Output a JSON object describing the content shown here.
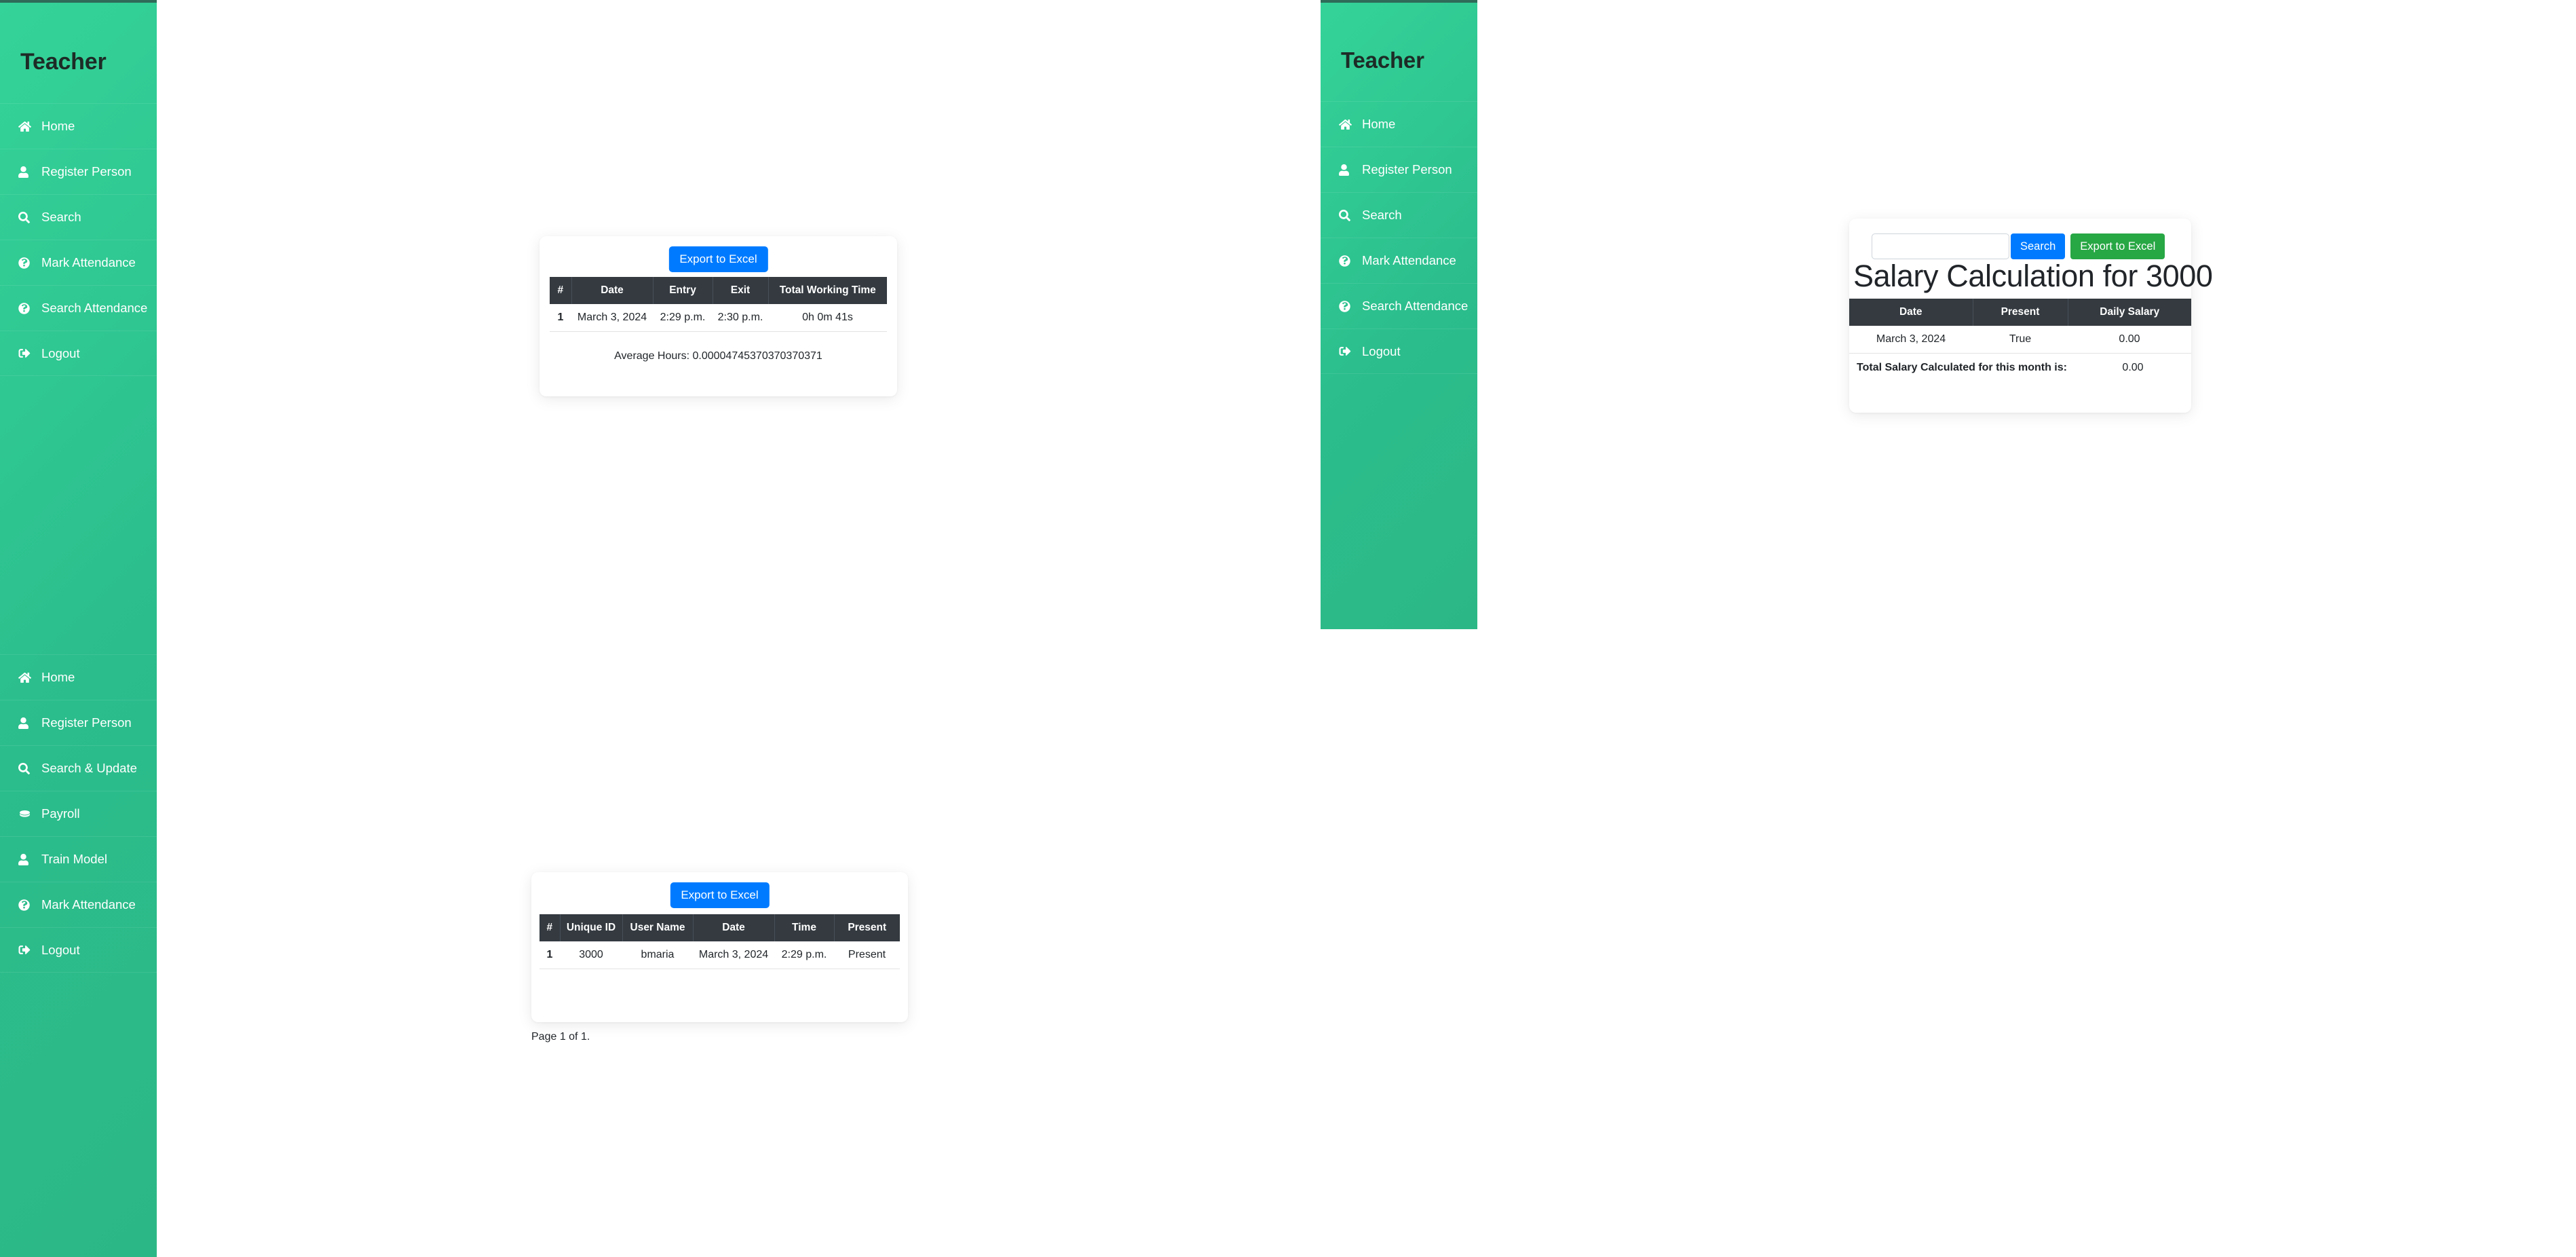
{
  "theme": {
    "sidebar_gradient_from": "#34d399",
    "sidebar_gradient_to": "#2cb886",
    "table_header_bg": "#343a40",
    "primary_button": "#007bff",
    "success_button": "#28a745"
  },
  "sidebar_primary": {
    "brand": "Teacher",
    "group_one": [
      {
        "label": "Home",
        "icon": "home-icon"
      },
      {
        "label": "Register Person",
        "icon": "user-icon"
      },
      {
        "label": "Search",
        "icon": "search-icon"
      },
      {
        "label": "Mark Attendance",
        "icon": "question-circle-icon"
      },
      {
        "label": "Search Attendance",
        "icon": "question-circle-icon"
      },
      {
        "label": "Logout",
        "icon": "logout-icon"
      }
    ],
    "group_two": [
      {
        "label": "Home",
        "icon": "home-icon"
      },
      {
        "label": "Register Person",
        "icon": "user-icon"
      },
      {
        "label": "Search & Update",
        "icon": "search-icon"
      },
      {
        "label": "Payroll",
        "icon": "coin-icon"
      },
      {
        "label": "Train Model",
        "icon": "user-icon"
      },
      {
        "label": "Mark Attendance",
        "icon": "question-circle-icon"
      },
      {
        "label": "Logout",
        "icon": "logout-icon"
      }
    ]
  },
  "sidebar_secondary": {
    "brand": "Teacher",
    "items": [
      {
        "label": "Home",
        "icon": "home-icon"
      },
      {
        "label": "Register Person",
        "icon": "user-icon"
      },
      {
        "label": "Search",
        "icon": "search-icon"
      },
      {
        "label": "Mark Attendance",
        "icon": "question-circle-icon"
      },
      {
        "label": "Search Attendance",
        "icon": "question-circle-icon"
      },
      {
        "label": "Logout",
        "icon": "logout-icon"
      }
    ]
  },
  "working_time_card": {
    "export_label": "Export to Excel",
    "columns": [
      "#",
      "Date",
      "Entry",
      "Exit",
      "Total Working Time"
    ],
    "rows": [
      {
        "index": "1",
        "date": "March 3, 2024",
        "entry": "2:29 p.m.",
        "exit": "2:30 p.m.",
        "total": "0h 0m 41s"
      }
    ],
    "average_hours": "Average Hours: 0.00004745370370370371"
  },
  "salary_card": {
    "search_value": "",
    "search_placeholder": "",
    "search_label": "Search",
    "export_label": "Export to Excel",
    "title": "Salary Calculation for 3000",
    "columns": [
      "Date",
      "Present",
      "Daily Salary"
    ],
    "rows": [
      {
        "date": "March 3, 2024",
        "present": "True",
        "daily_salary": "0.00"
      }
    ],
    "total_label": "Total Salary Calculated for this month is:",
    "total_value": "0.00"
  },
  "attendance_card": {
    "export_label": "Export to Excel",
    "columns": [
      "#",
      "Unique ID",
      "User Name",
      "Date",
      "Time",
      "Present"
    ],
    "rows": [
      {
        "index": "1",
        "unique_id": "3000",
        "user_name": "bmaria",
        "date": "March 3, 2024",
        "time": "2:29 p.m.",
        "present": "Present"
      }
    ],
    "page_info": "Page 1 of 1."
  }
}
